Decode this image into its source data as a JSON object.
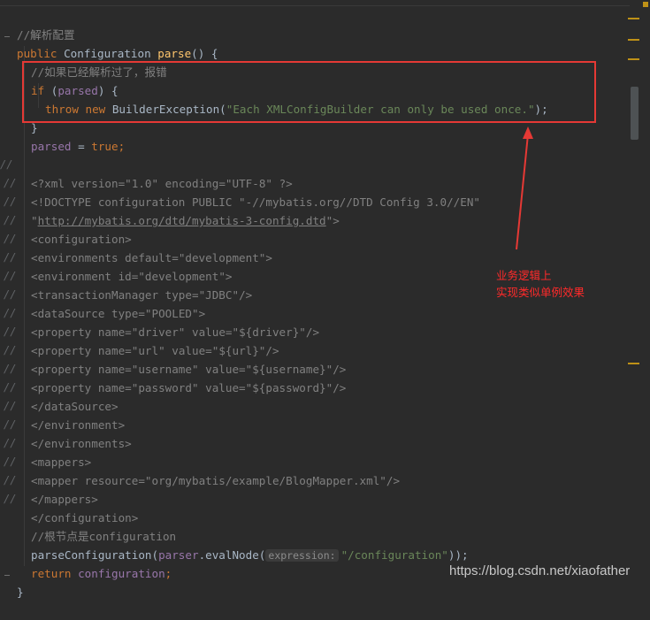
{
  "editor": {
    "lines": {
      "l1": {
        "gutter": "",
        "comment": "//解析配置"
      },
      "l2": {
        "gutter": "",
        "kw1": "public ",
        "type": "Configuration ",
        "method": "parse",
        "rest": "() {"
      },
      "l3": {
        "gutter": "",
        "comment": "//如果已经解析过了，报错"
      },
      "l4": {
        "gutter": "",
        "kw1": "if ",
        "p1": "(",
        "field": "parsed",
        "p2": ") {"
      },
      "l5": {
        "gutter": "",
        "kw1": "throw ",
        "kw2": "new ",
        "cls": "BuilderException(",
        "str": "\"Each XMLConfigBuilder can only be used once.\"",
        "end": ");"
      },
      "l6": {
        "gutter": "",
        "text": "}"
      },
      "l7": {
        "gutter": "",
        "field": "parsed",
        "eq": " = ",
        "kw": "true",
        "semi": ";"
      },
      "l8": {
        "gutter": "//",
        "pre": "<?xml version=",
        "s1": "\"1.0\"",
        "mid": " encoding=",
        "s2": "\"UTF-8\"",
        "post": " ?>"
      },
      "l9": {
        "gutter": "//",
        "pre": "<!DOCTYPE configuration PUBLIC ",
        "s1": "\"-//mybatis.org//DTD Config 3.0//EN\""
      },
      "l10": {
        "gutter": "//",
        "q1": "\"",
        "url": "http://mybatis.org/dtd/mybatis-3-config.dtd",
        "q2": "\"",
        "post": ">"
      },
      "l11": {
        "gutter": "//",
        "text": "<configuration>"
      },
      "l12": {
        "gutter": "//",
        "pre": "<environments default=",
        "s1": "\"development\"",
        "post": ">"
      },
      "l13": {
        "gutter": "//",
        "pre": "<environment id=",
        "s1": "\"development\"",
        "post": ">"
      },
      "l14": {
        "gutter": "//",
        "pre": "<transactionManager type=",
        "s1": "\"JDBC\"",
        "post": "/>"
      },
      "l15": {
        "gutter": "//",
        "pre": "<dataSource type=",
        "s1": "\"POOLED\"",
        "post": ">"
      },
      "l16": {
        "gutter": "//",
        "pre": "<property name=",
        "s1": "\"driver\"",
        "mid": " value=",
        "s2": "\"${driver}\"",
        "post": "/>"
      },
      "l17": {
        "gutter": "//",
        "pre": "<property name=",
        "s1": "\"url\"",
        "mid": " value=",
        "s2": "\"${url}\"",
        "post": "/>"
      },
      "l18": {
        "gutter": "//",
        "pre": "<property name=",
        "s1": "\"username\"",
        "mid": " value=",
        "s2": "\"${username}\"",
        "post": "/>"
      },
      "l19": {
        "gutter": "//",
        "pre": "<property name=",
        "s1": "\"password\"",
        "mid": " value=",
        "s2": "\"${password}\"",
        "post": "/>"
      },
      "l20": {
        "gutter": "//",
        "text": "</dataSource>"
      },
      "l21": {
        "gutter": "//",
        "text": "</environment>"
      },
      "l22": {
        "gutter": "//",
        "text": "</environments>"
      },
      "l23": {
        "gutter": "//",
        "text": "<mappers>"
      },
      "l24": {
        "gutter": "//",
        "pre": "<mapper resource=",
        "s1": "\"org/mybatis/example/BlogMapper.xml\"",
        "post": "/>"
      },
      "l25": {
        "gutter": "//",
        "text": "</mappers>"
      },
      "l26": {
        "gutter": "//",
        "text": "</configuration>"
      },
      "l28": {
        "gutter": "",
        "comment": "//根节点是configuration"
      },
      "l29": {
        "gutter": "",
        "method": "parseConfiguration(",
        "field": "parser",
        "dot": ".evalNode(",
        "hint": "expression:",
        "str": "\"/configuration\"",
        "end": "));"
      },
      "l30": {
        "gutter": "",
        "kw": "return ",
        "field": "configuration",
        "semi": ";"
      },
      "l31": {
        "gutter": "",
        "text": "}"
      }
    }
  },
  "annotation": {
    "line1": "业务逻辑上",
    "line2": "实现类似单例效果"
  },
  "watermark": "https://blog.csdn.net/xiaofather",
  "colors": {
    "annotation": "#e53935",
    "keyword": "#cc7832",
    "string": "#6a8759",
    "field": "#9876aa",
    "comment": "#808080"
  }
}
